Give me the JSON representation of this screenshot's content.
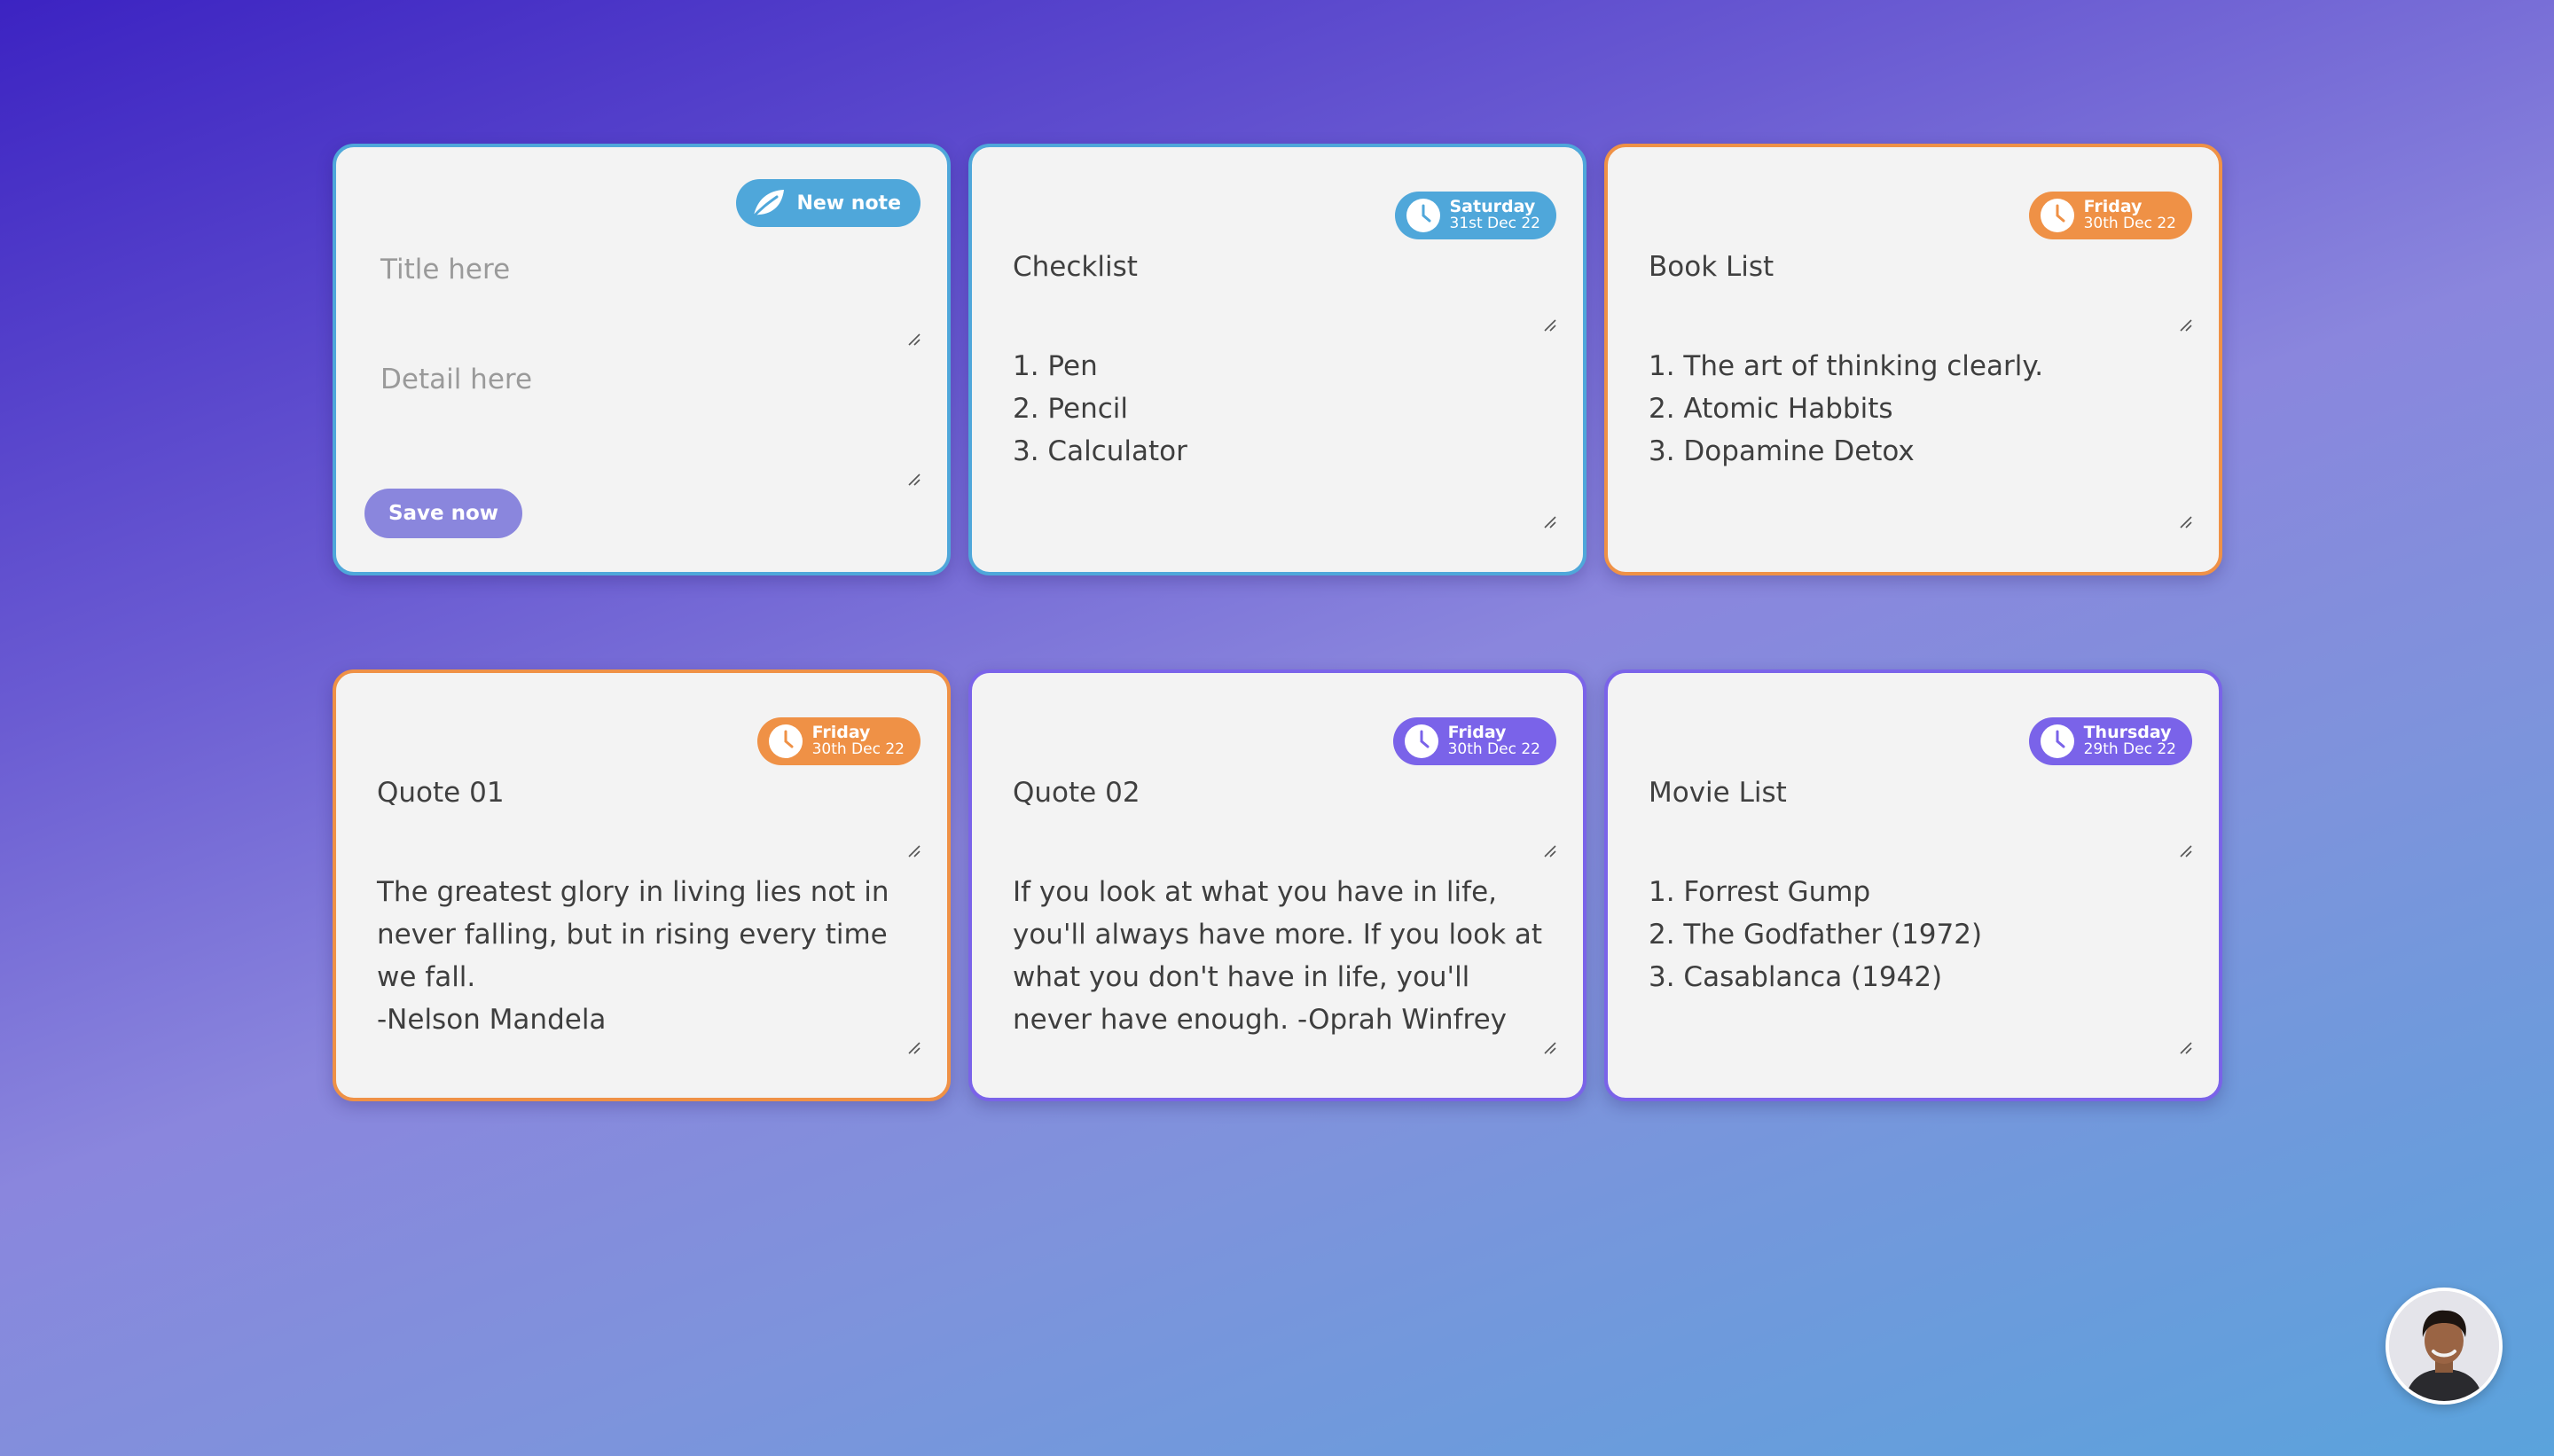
{
  "new_note": {
    "badge_label": "New note",
    "title_placeholder": "Title here",
    "detail_placeholder": "Detail here",
    "save_label": "Save now"
  },
  "notes": [
    {
      "title": "Checklist",
      "day": "Saturday",
      "date": "31st Dec 22",
      "color": "#4fa7da",
      "body": "1. Pen\n2. Pencil\n3. Calculator"
    },
    {
      "title": "Book List",
      "day": "Friday",
      "date": "30th Dec 22",
      "color": "#ef9146",
      "body": "1. The art of thinking clearly.\n2. Atomic Habbits\n3. Dopamine Detox"
    },
    {
      "title": "Quote 01",
      "day": "Friday",
      "date": "30th Dec 22",
      "color": "#ef9146",
      "body": "The greatest glory in living lies not in never falling, but in rising every time we fall.\n-Nelson Mandela"
    },
    {
      "title": "Quote 02",
      "day": "Friday",
      "date": "30th Dec 22",
      "color": "#7a63e9",
      "body": "If you look at what you have in life, you'll always have more. If you look at what you don't have in life, you'll never have enough. -Oprah Winfrey"
    },
    {
      "title": "Movie List",
      "day": "Thursday",
      "date": "29th Dec 22",
      "color": "#7a63e9",
      "body": "1. Forrest Gump\n2. The Godfather (1972)\n3. Casablanca (1942)"
    }
  ],
  "icons": {
    "new_note": "leaf-icon",
    "date_badge": "clock-icon",
    "resize": "resize-grip-icon",
    "profile": "avatar"
  }
}
